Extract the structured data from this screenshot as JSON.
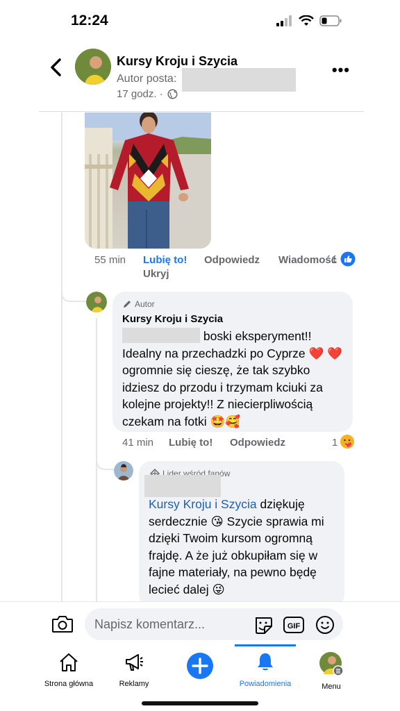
{
  "status_bar": {
    "time": "12:24"
  },
  "header": {
    "page_name": "Kursy Kroju i Szycia",
    "author_label": "Autor posta:",
    "time_ago": "17 godz. ·"
  },
  "reply1_meta": {
    "time": "55 min",
    "like": "Lubię to!",
    "reply": "Odpowiedz",
    "message": "Wiadomość",
    "count": "1",
    "hide": "Ukryj"
  },
  "comment_author": {
    "badge": "Autor",
    "name": "Kursy Kroju i Szycia",
    "text_first": "boski eksperyment!!",
    "text_rest": "Idealny na przechadzki po Cyprze ❤️ ❤️ ogromnie się cieszę, że tak szybko idziesz do przodu i trzymam kciuki za kolejne projekty!! Z niecierpliwością czekam na fotki 🤩🥰",
    "time": "41 min",
    "like": "Lubię to!",
    "reply": "Odpowiedz",
    "reaction_count": "1"
  },
  "comment_fan": {
    "badge": "Lider wśród fanów",
    "mention": "Kursy Kroju i Szycia",
    "text_after_mention": "dziękuję serdecznie 😘",
    "text_rest": "Szycie sprawia mi dzięki Twoim kursom ogromną frajdę. A że już obkupiłam się w fajne materiały, na pewno będę lecieć dalej 😜"
  },
  "composer": {
    "placeholder": "Napisz komentarz..."
  },
  "tabs": [
    {
      "label": "Strona główna",
      "icon": "home-icon"
    },
    {
      "label": "Reklamy",
      "icon": "megaphone-icon"
    },
    {
      "label": "",
      "icon": "plus-icon"
    },
    {
      "label": "Powiadomienia",
      "icon": "bell-icon",
      "active": true
    },
    {
      "label": "Menu",
      "icon": "avatar-menu-icon"
    }
  ],
  "colors": {
    "facebook_blue": "#1877f2",
    "bubble_bg": "#f0f2f5",
    "secondary_text": "#65676b"
  }
}
